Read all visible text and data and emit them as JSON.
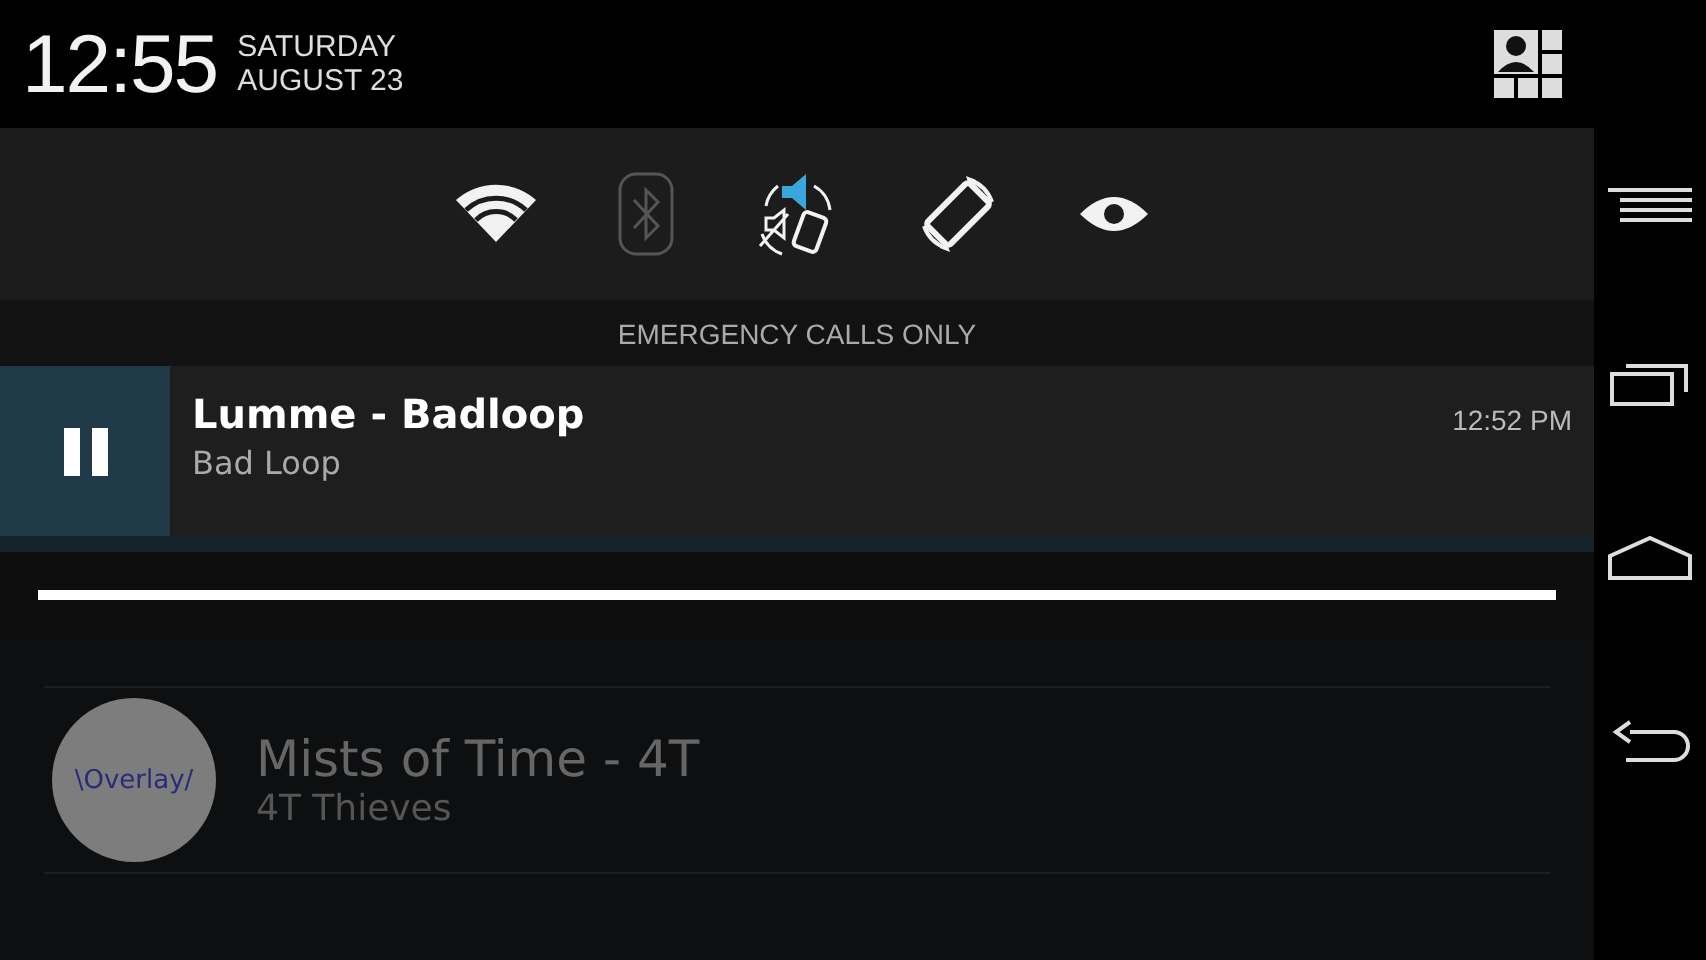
{
  "status_bar": {
    "time": "12:55",
    "day": "SATURDAY",
    "date": "AUGUST 23"
  },
  "quick_settings": [
    {
      "kind": "wifi",
      "on": true
    },
    {
      "kind": "bluetooth",
      "on": false
    },
    {
      "kind": "sound",
      "on": true
    },
    {
      "kind": "rotation",
      "on": true
    },
    {
      "kind": "eye",
      "on": true
    }
  ],
  "carrier_label": "EMERGENCY CALLS ONLY",
  "notification": {
    "title": "Lumme - Badloop",
    "text": "Bad Loop",
    "time": "12:52 PM",
    "playing": true,
    "progress": {
      "level": 1
    }
  },
  "background_list": [
    {
      "title": "Mists of Time - 4T",
      "subtitle": "4T Thieves",
      "art_text": "\\Overlay/"
    }
  ],
  "nav_bar": [
    {
      "kind": "menu"
    },
    {
      "kind": "recents"
    },
    {
      "kind": "home"
    },
    {
      "kind": "back"
    }
  ]
}
